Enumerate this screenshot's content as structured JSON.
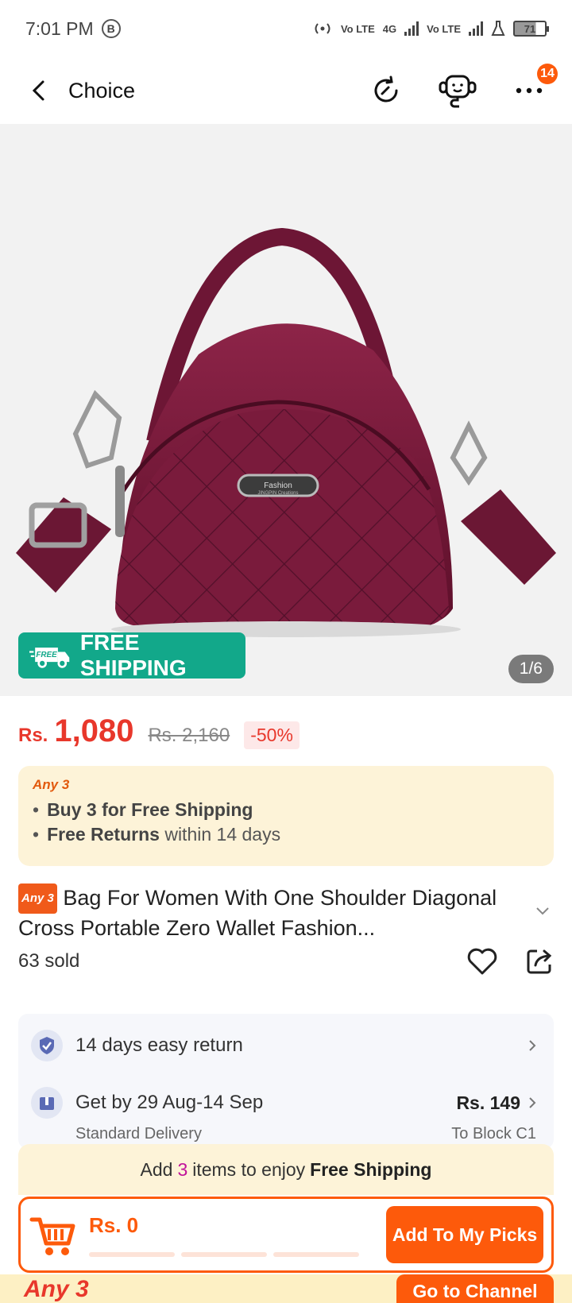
{
  "status_bar": {
    "time": "7:01 PM",
    "b_label": "B",
    "net1": "Vo LTE",
    "net2": "4G",
    "net3": "Vo LTE",
    "battery": "71"
  },
  "header": {
    "title": "Choice",
    "cart_badge": "14"
  },
  "gallery": {
    "free_shipping_tag": "FREE",
    "free_shipping_label": "FREE SHIPPING",
    "page_indicator": "1/6",
    "product_color": "#7a1a3a",
    "plate_line1": "Fashion",
    "plate_line2": "JINGPIN Creations"
  },
  "price": {
    "currency": "Rs.",
    "current": "1,080",
    "original": "Rs. 2,160",
    "discount": "-50%"
  },
  "offer": {
    "label": "Any 3",
    "line1_bold": "Buy 3 for  Free Shipping",
    "line2_bold": "Free Returns",
    "line2_rest": "within 14 days"
  },
  "product": {
    "chip": "Any 3",
    "title": "Bag For Women With One Shoulder Diagonal Cross Portable Zero Wallet Fashion...",
    "sold": "63 sold"
  },
  "service": {
    "return_text": "14 days easy return",
    "delivery_text": "Get by 29 Aug-14 Sep",
    "delivery_sub": "Standard Delivery",
    "delivery_price": "Rs. 149",
    "delivery_to": "To Block C1"
  },
  "bottom": {
    "promo_pre": "Add",
    "promo_num": "3",
    "promo_mid": "items to enjoy",
    "promo_bold": "Free Shipping",
    "cart_total": "Rs. 0",
    "add_button": "Add To My Picks",
    "channel_logo": "Any 3",
    "channel_button": "Go to Channel"
  },
  "colors": {
    "accent": "#fd5a0b",
    "price": "#e8372b",
    "free_shipping": "#12a88a"
  }
}
